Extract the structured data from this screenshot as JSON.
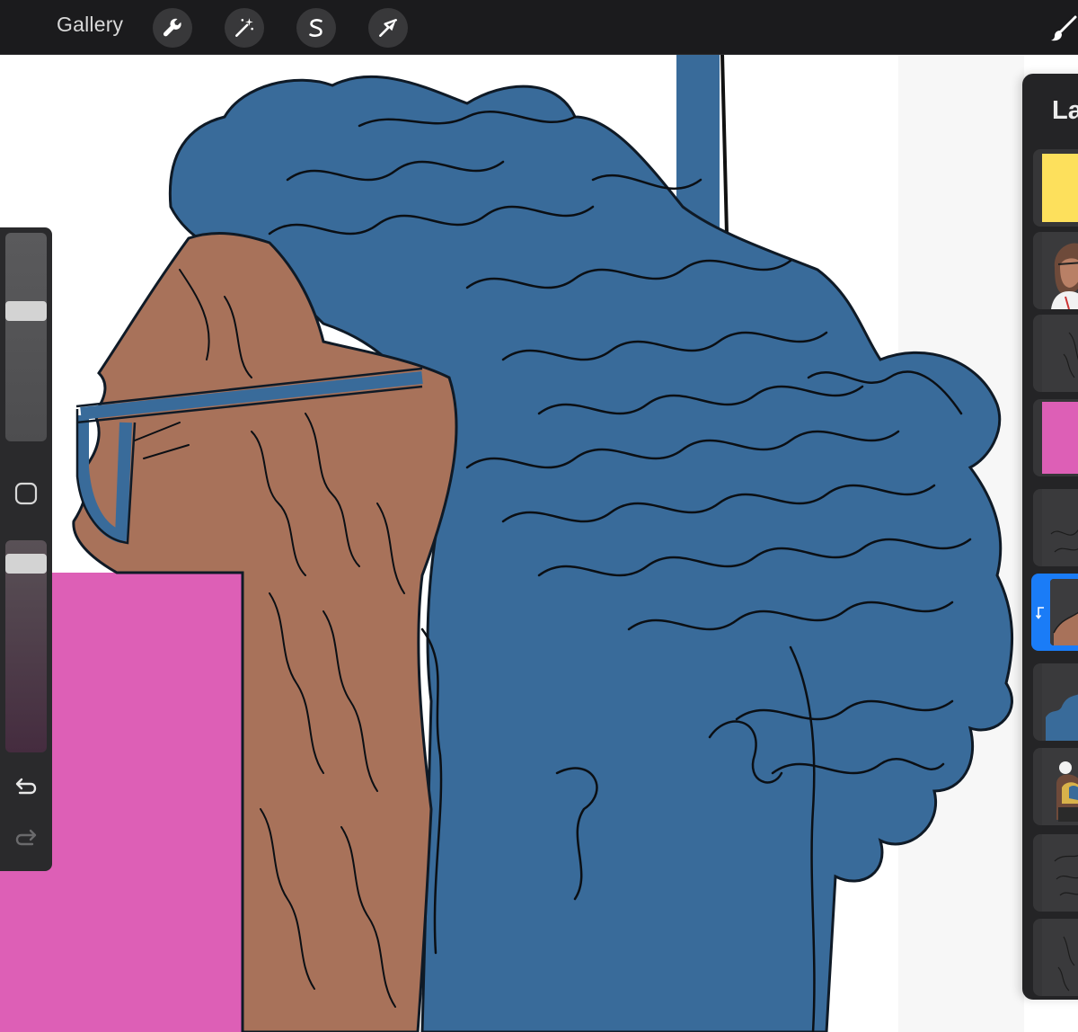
{
  "toolbar": {
    "gallery_label": "Gallery",
    "tools": [
      {
        "name": "actions",
        "icon": "wrench-icon"
      },
      {
        "name": "adjustments",
        "icon": "magic-wand-icon"
      },
      {
        "name": "selection",
        "icon": "selection-s-icon"
      },
      {
        "name": "transform",
        "icon": "arrow-cursor-icon"
      }
    ],
    "active_tool_icon": "brush-icon"
  },
  "sidebar": {
    "brush_size_level": 0.64,
    "brush_opacity_level": 0.93,
    "modify_icon": "square-icon",
    "undo_icon": "undo-arrow-icon",
    "redo_icon": "redo-arrow-icon"
  },
  "layers_panel": {
    "title": "Layers",
    "selected_index": 5,
    "layers": [
      {
        "thumbnail": "yellow-fill",
        "color": "#fde05c"
      },
      {
        "thumbnail": "portrait-sketch-color"
      },
      {
        "thumbnail": "line-sketch"
      },
      {
        "thumbnail": "pink-fill",
        "color": "#dd5fb6"
      },
      {
        "thumbnail": "line-sketch"
      },
      {
        "thumbnail": "skin-fill-clipped",
        "color": "#a8725a"
      },
      {
        "thumbnail": "blue-fill",
        "color": "#396b9a"
      },
      {
        "thumbnail": "color-reference"
      },
      {
        "thumbnail": "line-sketch"
      },
      {
        "thumbnail": "line-sketch"
      }
    ]
  },
  "colors": {
    "hair_blue": "#396b9a",
    "skin_brown": "#a8725a",
    "background_pink": "#dd5fb6",
    "accent_blue": "#1a7cf7"
  }
}
